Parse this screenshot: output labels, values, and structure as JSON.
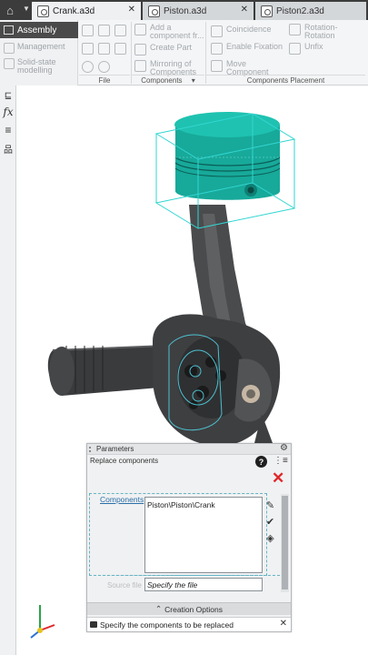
{
  "tabs": [
    {
      "label": "Crank.a3d",
      "active": true
    },
    {
      "label": "Piston.a3d",
      "active": false
    },
    {
      "label": "Piston2.a3d",
      "active": false
    }
  ],
  "ribbon": {
    "mode_tab": "Assembly",
    "left_items": [
      "Management",
      "Solid-state modelling"
    ],
    "components_buttons": [
      "Add a component fr...",
      "Create Part",
      "Mirroring of Components"
    ],
    "placement_buttons": [
      "Coincidence",
      "Enable Fixation",
      "Move Component"
    ],
    "placement_right_buttons": [
      "Rotation-Rotation",
      "Unfix"
    ],
    "groups": {
      "file": "File",
      "components": "Components",
      "placement": "Components Placement"
    }
  },
  "panel": {
    "title": "Parameters",
    "subtitle": "Replace components",
    "components_label": "Components",
    "list_items": [
      "Piston\\Piston\\Crank"
    ],
    "specify_label": "Source file",
    "specify_value": "Specify the file",
    "creation_options": "Creation Options",
    "status_message": "Specify the components to be replaced"
  },
  "colors": {
    "piston": "#17a99a",
    "selection_box": "#32d6d2",
    "close": "#e0262b",
    "titlebar": "#3c3c3c"
  },
  "icons": [
    "home-icon",
    "document-icon",
    "help-icon",
    "tree-icon",
    "close-icon",
    "gear-icon",
    "function-icon",
    "layers-icon",
    "hierarchy-icon"
  ]
}
